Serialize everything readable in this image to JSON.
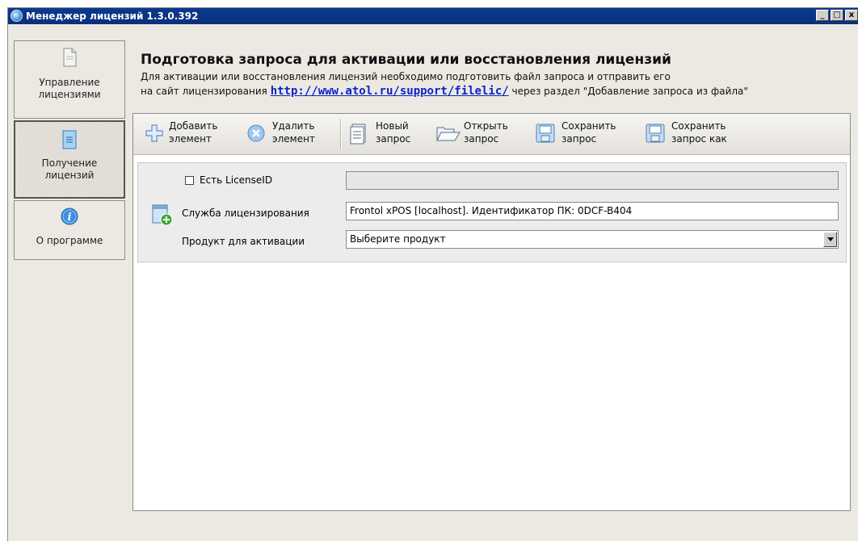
{
  "window": {
    "title": "Менеджер лицензий 1.3.0.392",
    "minimize": "_",
    "maximize": "□",
    "close": "x"
  },
  "nav": {
    "items": [
      {
        "label": "Управление лицензиями",
        "icon": "document-icon",
        "active": false
      },
      {
        "label": "Получение лицензий",
        "icon": "blue-doc-icon",
        "active": true
      },
      {
        "label": "О программе",
        "icon": "info-icon",
        "active": false
      }
    ]
  },
  "header": {
    "title": "Подготовка запроса для активации или восстановления лицензий",
    "line1": "Для активации или восстановления лицензий необходимо подготовить файл запроса и отправить его",
    "line2_prefix": "на сайт лицензирования ",
    "link": "http://www.atol.ru/support/filelic/",
    "line2_suffix": " через раздел \"Добавление запроса из файла\""
  },
  "toolbar": {
    "add": {
      "l1": "Добавить",
      "l2": "элемент",
      "icon": "plus-icon"
    },
    "remove": {
      "l1": "Удалить",
      "l2": "элемент",
      "icon": "remove-circle-icon"
    },
    "new": {
      "l1": "Новый",
      "l2": "запрос",
      "icon": "new-document-icon"
    },
    "open": {
      "l1": "Открыть",
      "l2": "запрос",
      "icon": "folder-open-icon"
    },
    "save": {
      "l1": "Сохранить",
      "l2": "запрос",
      "icon": "save-icon"
    },
    "save_as": {
      "l1": "Сохранить",
      "l2": "запрос как",
      "icon": "save-as-icon"
    }
  },
  "form": {
    "license_id_label": "Есть LicenseID",
    "license_id_checked": false,
    "license_id_value": "",
    "service_label": "Служба лицензирования",
    "service_value": "Frontol xPOS [localhost]. Идентификатор ПК: 0DCF-B404",
    "product_label": "Продукт для активации",
    "product_value": "Выберите продукт"
  },
  "colors": {
    "titlebar": "#0a3a8f",
    "link": "#0b24c8",
    "window_bg": "#ece9e3"
  }
}
